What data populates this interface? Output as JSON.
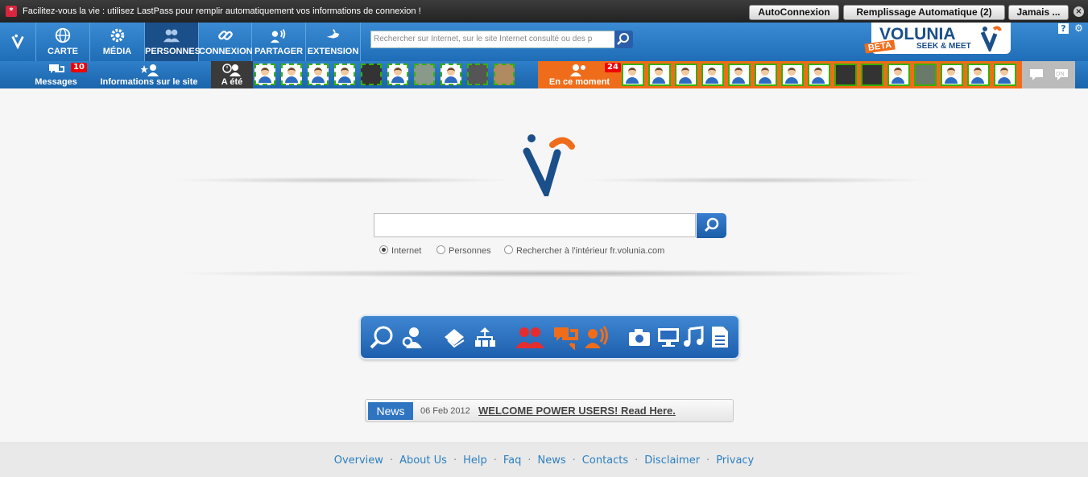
{
  "lastpass": {
    "message": "Facilitez-vous la vie : utilisez LastPass pour remplir automatiquement vos informations de connexion !",
    "btn_auto": "AutoConnexion",
    "btn_fill": "Remplissage Automatique (2)",
    "btn_never": "Jamais ..."
  },
  "nav": {
    "items": [
      {
        "label": "CARTE"
      },
      {
        "label": "MÉDIA"
      },
      {
        "label": "PERSONNES"
      },
      {
        "label": "CONNEXION"
      },
      {
        "label": "PARTAGER"
      },
      {
        "label": "EXTENSION"
      }
    ],
    "search_placeholder": "Rechercher sur Internet, sur le site Internet consulté ou des p",
    "logo_name": "VOLUNIA",
    "logo_tagline": "SEEK & MEET",
    "logo_beta": "BETA",
    "help": "?"
  },
  "bar2": {
    "messages_label": "Messages",
    "messages_count": "10",
    "site_info_label": "Informations sur le site",
    "was_label": "A été",
    "moment_label": "En ce moment",
    "moment_count": "24"
  },
  "search": {
    "radio_internet": "Internet",
    "radio_people": "Personnes",
    "radio_site": "Rechercher à l'intérieur fr.volunia.com"
  },
  "news": {
    "label": "News",
    "date": "06 Feb 2012",
    "title": "WELCOME POWER USERS! Read Here."
  },
  "footer": {
    "links": [
      "Overview",
      "About Us",
      "Help",
      "Faq",
      "News",
      "Contacts",
      "Disclaimer",
      "Privacy"
    ]
  },
  "colors": {
    "brand_blue": "#1f6db7",
    "brand_orange": "#ef6d1a",
    "presence_green": "#38b000"
  }
}
